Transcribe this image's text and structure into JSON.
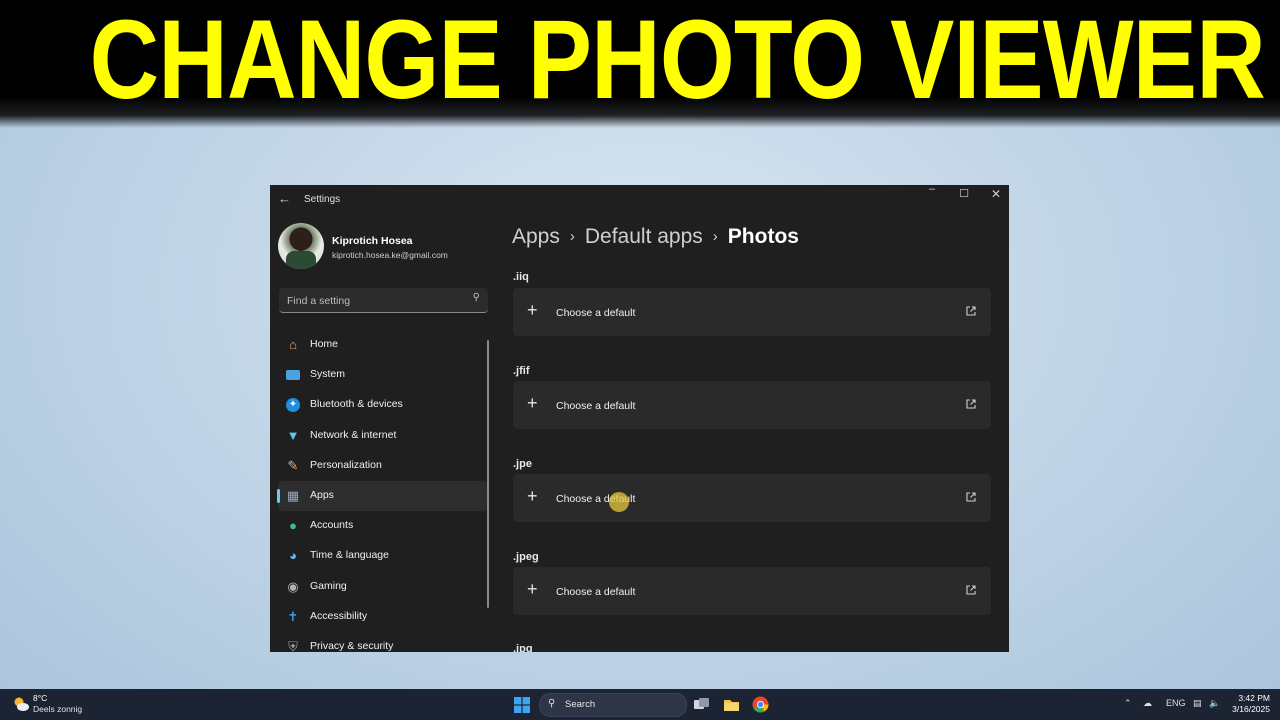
{
  "banner": {
    "text": "CHANGE PHOTO VIEWER"
  },
  "window": {
    "title": "Settings",
    "controls": {
      "minimize": "–",
      "maximize": "☐",
      "close": "✕"
    }
  },
  "user": {
    "name": "Kiprotich Hosea",
    "email": "kiprotich.hosea.ke@gmail.com"
  },
  "search": {
    "placeholder": "Find a setting"
  },
  "nav": {
    "items": [
      {
        "label": "Home",
        "icon": "home-icon"
      },
      {
        "label": "System",
        "icon": "system-icon"
      },
      {
        "label": "Bluetooth & devices",
        "icon": "bluetooth-icon"
      },
      {
        "label": "Network & internet",
        "icon": "wifi-icon"
      },
      {
        "label": "Personalization",
        "icon": "brush-icon"
      },
      {
        "label": "Apps",
        "icon": "apps-icon",
        "selected": true
      },
      {
        "label": "Accounts",
        "icon": "person-icon"
      },
      {
        "label": "Time & language",
        "icon": "globe-clock-icon"
      },
      {
        "label": "Gaming",
        "icon": "gamepad-icon"
      },
      {
        "label": "Accessibility",
        "icon": "accessibility-icon"
      },
      {
        "label": "Privacy & security",
        "icon": "shield-icon"
      }
    ]
  },
  "breadcrumb": {
    "part1": "Apps",
    "part2": "Default apps",
    "current": "Photos",
    "separator": "›"
  },
  "file_types": [
    {
      "ext": ".iiq",
      "action": "Choose a default"
    },
    {
      "ext": ".jfif",
      "action": "Choose a default"
    },
    {
      "ext": ".jpe",
      "action": "Choose a default"
    },
    {
      "ext": ".jpeg",
      "action": "Choose a default"
    },
    {
      "ext": ".jpg"
    }
  ],
  "taskbar": {
    "weather_temp": "8°C",
    "weather_desc": "Deels zonnig",
    "search_label": "Search",
    "language": "ENG",
    "time": "3:42 PM",
    "date": "3/16/2025"
  },
  "colors": {
    "banner_text": "#ffff00",
    "accent": "#60cdff",
    "window_bg": "#1f1f1f"
  }
}
